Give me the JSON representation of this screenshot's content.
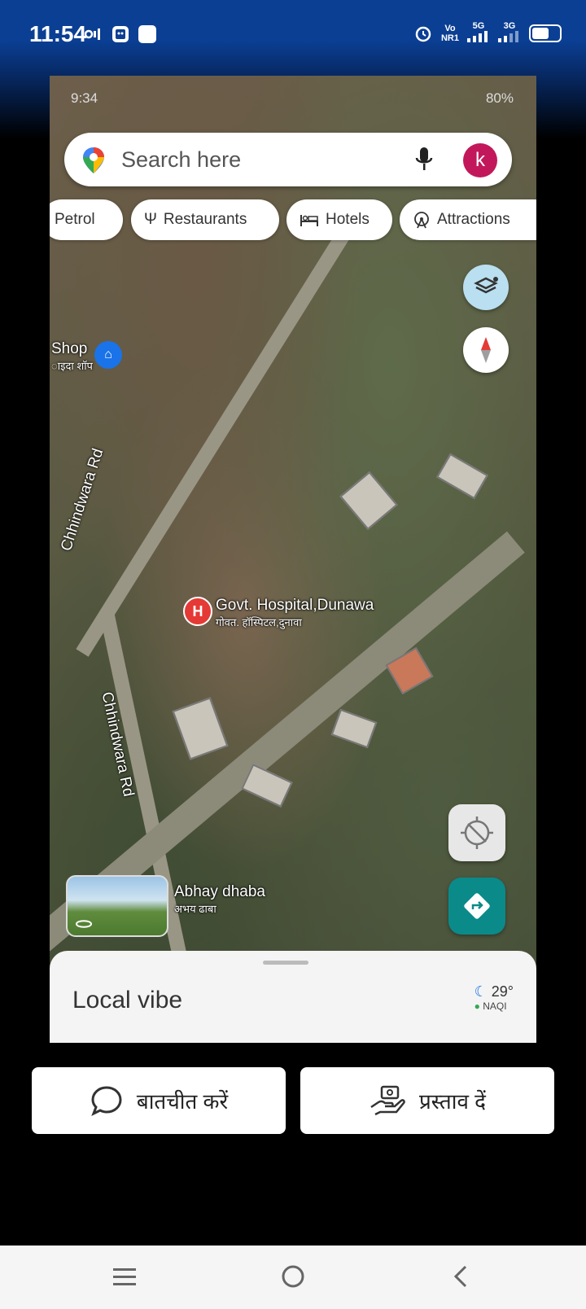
{
  "status_bar": {
    "time": "11:54",
    "network_label_top": "Vo",
    "network_label_bottom": "NR1",
    "sim1": "5G",
    "sim2": "3G",
    "bg_color": "#0b3f94"
  },
  "screenshot": {
    "inner_time": "9:34",
    "inner_battery": "80%",
    "search": {
      "placeholder": "Search here",
      "avatar_letter": "k"
    },
    "chips": [
      "Petrol",
      "Restaurants",
      "Hotels",
      "Attractions"
    ],
    "labels": {
      "shop_main": "Shop",
      "shop_sub": "ाइदा शॉप",
      "road_1": "Chhindwara Rd",
      "road_2": "Chhindwara Rd",
      "hospital_main": "Govt. Hospital,Dunawa",
      "hospital_sub": "गोवत. हॉस्पिटल,दुनावा",
      "dhaba_main": "Abhay dhaba",
      "dhaba_sub": "अभय ढाबा"
    },
    "sheet": {
      "title": "Local vibe",
      "temperature": "29°",
      "aqi": "NAQI"
    }
  },
  "actions": {
    "chat_label": "बातचीत करें",
    "offer_label": "प्रस्ताव दें"
  },
  "icons": [
    "wifi-icon",
    "photo-icon",
    "alarm-icon",
    "battery-icon",
    "google-maps-pin-icon",
    "mic-icon",
    "utensils-icon",
    "bed-icon",
    "ferris-wheel-icon",
    "layers-icon",
    "compass-icon",
    "locate-icon",
    "directions-icon",
    "chat-bubble-icon",
    "hand-offer-icon",
    "menu-icon",
    "home-icon",
    "back-icon"
  ]
}
